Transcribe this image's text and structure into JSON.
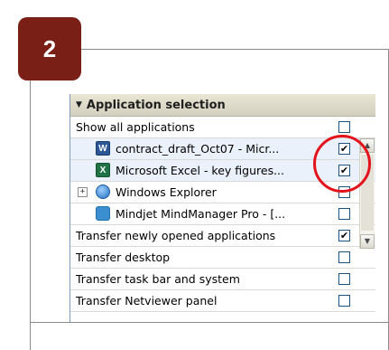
{
  "step": {
    "number": "2"
  },
  "panel": {
    "title": "Application selection",
    "rows": [
      {
        "label": "Show all applications",
        "checked": false
      },
      {
        "label": "contract_draft_Oct07 - Micr...",
        "icon": "word-icon",
        "icon_glyph": "W",
        "checked": true
      },
      {
        "label": "Microsoft Excel - key figures...",
        "icon": "excel-icon",
        "icon_glyph": "X",
        "checked": true
      },
      {
        "label": "Windows Explorer",
        "icon": "windows-explorer-icon",
        "expander": "+",
        "checked": false
      },
      {
        "label": "Mindjet MindManager Pro - [...",
        "icon": "mindjet-icon",
        "checked": false
      },
      {
        "label": "Transfer newly opened applications",
        "checked": true
      },
      {
        "label": "Transfer desktop",
        "checked": false
      },
      {
        "label": "Transfer task bar and system",
        "checked": false
      },
      {
        "label": "Transfer Netviewer panel",
        "checked": false
      }
    ],
    "check_mark": "✔"
  },
  "colors": {
    "badge": "#7a1f16",
    "highlight": "#e3121b"
  }
}
